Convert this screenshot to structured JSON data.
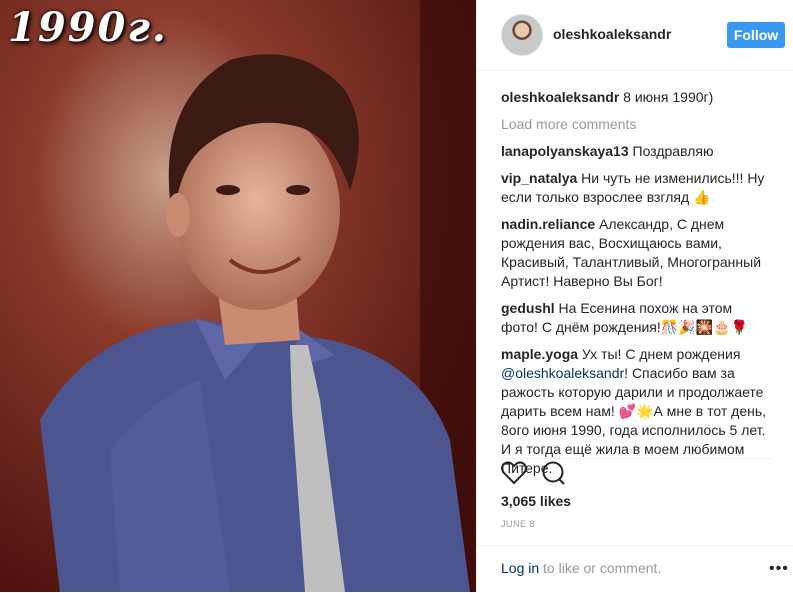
{
  "photo": {
    "caption": "1990г."
  },
  "post": {
    "username": "oleshkoaleksandr",
    "follow_label": "Follow",
    "caption_user": "oleshkoaleksandr",
    "caption_text": " 8 июня 1990г)",
    "load_more": "Load more comments",
    "comments": [
      {
        "user": "lanapolyanskaya13",
        "text": " Поздравляю"
      },
      {
        "user": "vip_natalya",
        "text": " Ни чуть не изменились!!! Ну если только взрослее взгляд 👍"
      },
      {
        "user": "nadin.reliance",
        "text": " Александр, С днем рождения вас, Восхищаюсь вами, Красивый, Талантливый, Многогранный Артист! Наверно Вы Бог!"
      },
      {
        "user": "gedushl",
        "text": " На Есенина похож на этом фото! С днём рождения!🎊🎉🎇🎂🌹"
      },
      {
        "user": "maple.yoga",
        "text_before": " Ух ты! С днем рождения ",
        "mention": "@oleshkoaleksandr",
        "text_after": "! Спасибо вам за ражость которую дарили и продолжаете дарить всем нам! 💕🌟А мне в тот день, 8ого июня 1990, года исполнилось 5 лет. И я тогда ещё жила в моем любимом Питере."
      }
    ],
    "likes": "3,065 likes",
    "date": "JUNE 8",
    "login_link": "Log in",
    "login_text": " to like or comment.",
    "icons": [
      "heart-icon",
      "comment-icon",
      "more-icon"
    ]
  }
}
